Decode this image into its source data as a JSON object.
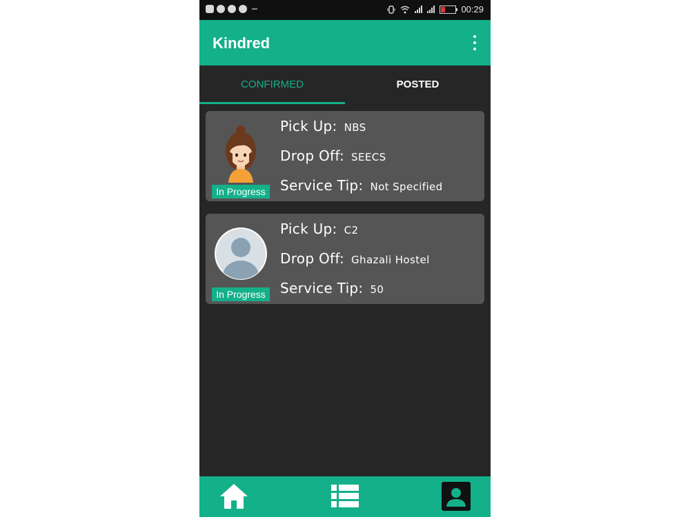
{
  "status_bar": {
    "time": "00:29",
    "icons": [
      "facebook-icon",
      "whatsapp-icon",
      "messenger-icon",
      "messenger-icon",
      "vibrate-icon",
      "wifi-icon",
      "signal-icon",
      "signal-icon",
      "battery-icon"
    ],
    "battery_color": "#e03434"
  },
  "app_bar": {
    "title": "Kindred",
    "menu_icon": "overflow-menu-icon",
    "color": "#14b08a"
  },
  "tabs": [
    {
      "label": "CONFIRMED",
      "active": true
    },
    {
      "label": "POSTED",
      "active": false
    }
  ],
  "requests": [
    {
      "avatar": "female-avatar",
      "status": "In Progress",
      "pickup_label": "Pick Up:",
      "pickup": "NBS",
      "dropoff_label": "Drop Off:",
      "dropoff": "SEECS",
      "tip_label": "Service Tip:",
      "tip": "Not Specified"
    },
    {
      "avatar": "default-user-avatar",
      "status": "In Progress",
      "pickup_label": "Pick Up:",
      "pickup": "C2",
      "dropoff_label": "Drop Off:",
      "dropoff": "Ghazali Hostel",
      "tip_label": "Service Tip:",
      "tip": "50"
    }
  ],
  "bottom_nav": [
    "home-icon",
    "list-icon",
    "profile-icon"
  ],
  "colors": {
    "accent": "#14b08a",
    "background": "#262626",
    "card": "#555555"
  }
}
